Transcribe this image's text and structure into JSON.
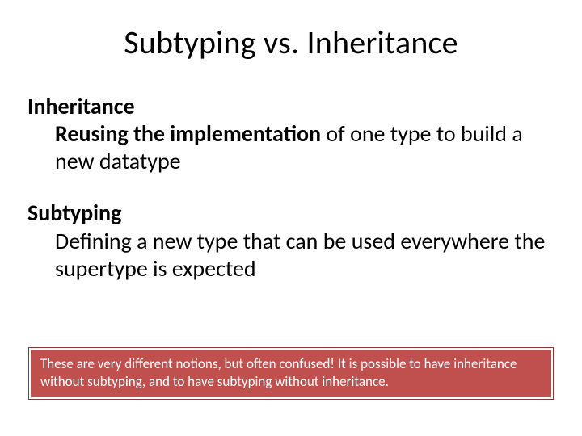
{
  "title": "Subtyping vs. Inheritance",
  "section1": {
    "heading": "Inheritance",
    "bold_lead": "Reusing the implementation",
    "rest": " of one type to build a new datatype"
  },
  "section2": {
    "heading": "Subtyping",
    "text": "Defining a new type that can be used everywhere the supertype is expected"
  },
  "callout": "These are very different notions, but often confused!  It is possible to have inheritance without subtyping, and to have subtyping without inheritance."
}
